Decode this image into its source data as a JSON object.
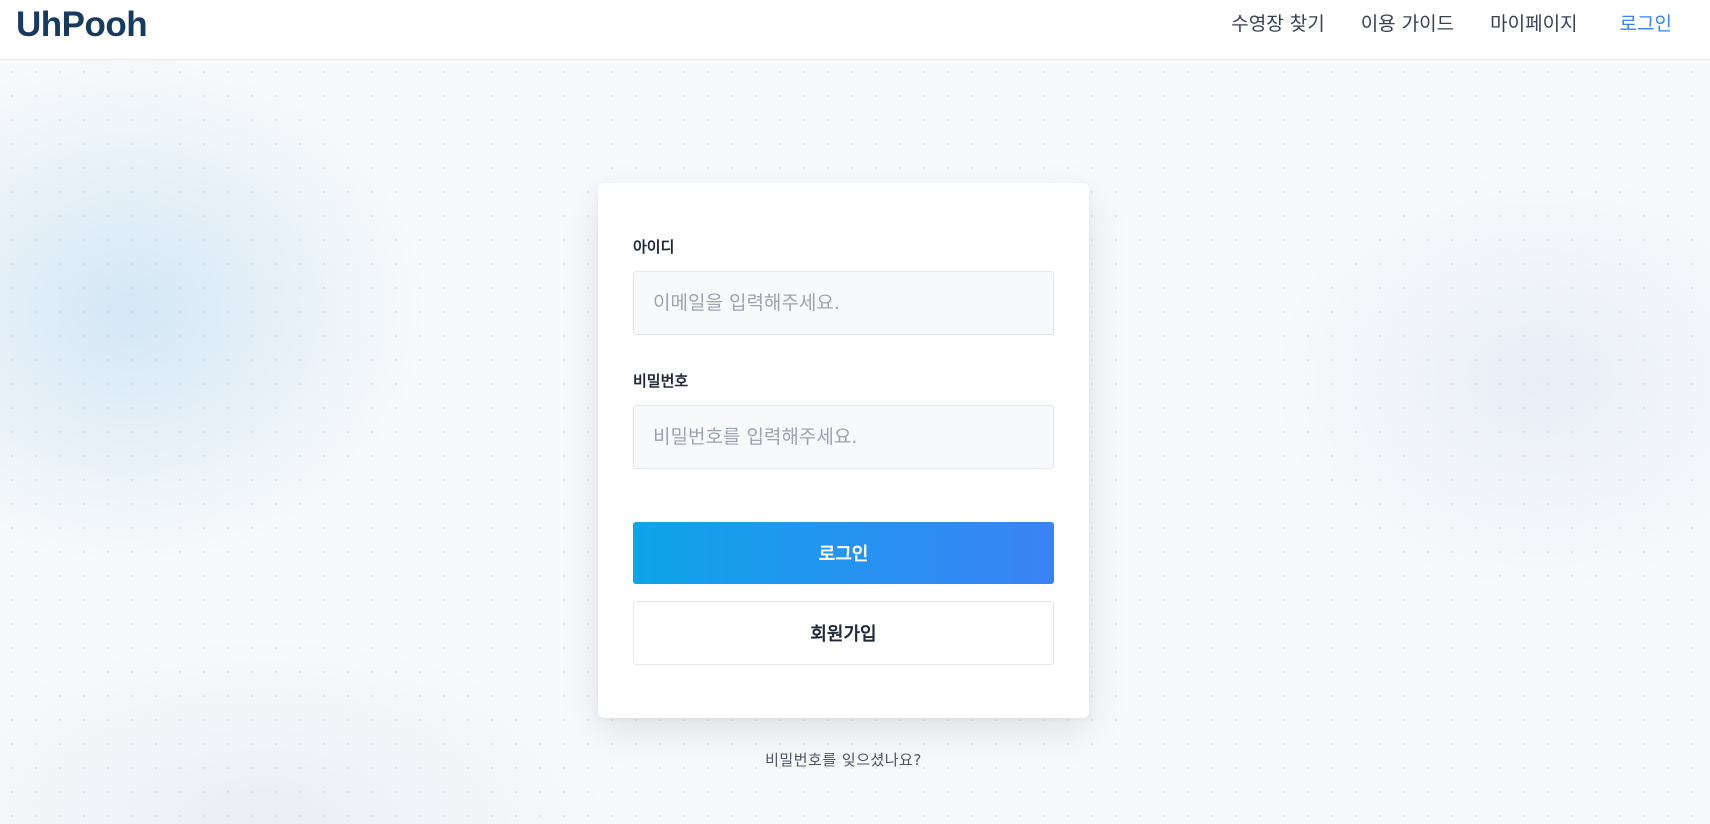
{
  "header": {
    "logo": "UhPooh",
    "nav": [
      {
        "label": "수영장 찾기"
      },
      {
        "label": "이용 가이드"
      },
      {
        "label": "마이페이지"
      },
      {
        "label": "로그인"
      }
    ],
    "active_color": "#3b82f6"
  },
  "login": {
    "id_label": "아이디",
    "id_placeholder": "이메일을 입력해주세요.",
    "password_label": "비밀번호",
    "password_placeholder": "비밀번호를 입력해주세요.",
    "login_button": "로그인",
    "signup_button": "회원가입",
    "forgot_link": "비밀번호를 잊으셨나요?",
    "button_gradient": [
      "#0ea5e9",
      "#3b82f6"
    ]
  }
}
